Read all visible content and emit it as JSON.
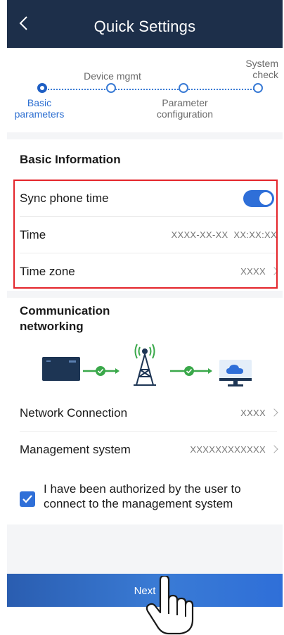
{
  "header": {
    "title": "Quick Settings"
  },
  "stepper": {
    "steps": [
      {
        "label": "Basic\nparameters",
        "active": true
      },
      {
        "label": "Device mgmt",
        "active": false
      },
      {
        "label": "Parameter\nconfiguration",
        "active": false
      },
      {
        "label": "System\ncheck",
        "active": false
      }
    ]
  },
  "basic_info": {
    "title": "Basic Information",
    "rows": [
      {
        "label": "Sync phone time",
        "toggle_on": true
      },
      {
        "label": "Time",
        "value": "XXXX-XX-XX  XX:XX:XX"
      },
      {
        "label": "Time zone",
        "value": "XXXX"
      }
    ]
  },
  "communication": {
    "title": "Communication\nnetworking",
    "rows": [
      {
        "label": "Network Connection",
        "value": "XXXX"
      },
      {
        "label": "Management system",
        "value": "XXXXXXXXXXXX"
      }
    ],
    "consent_checked": true,
    "consent_text": "I have been authorized by the user to connect to the management system"
  },
  "footer": {
    "next_label": "Next"
  },
  "colors": {
    "header_bg": "#1d2f4a",
    "accent": "#2f6fd8",
    "highlight": "#e4252b",
    "connector": "#3aa84a"
  }
}
